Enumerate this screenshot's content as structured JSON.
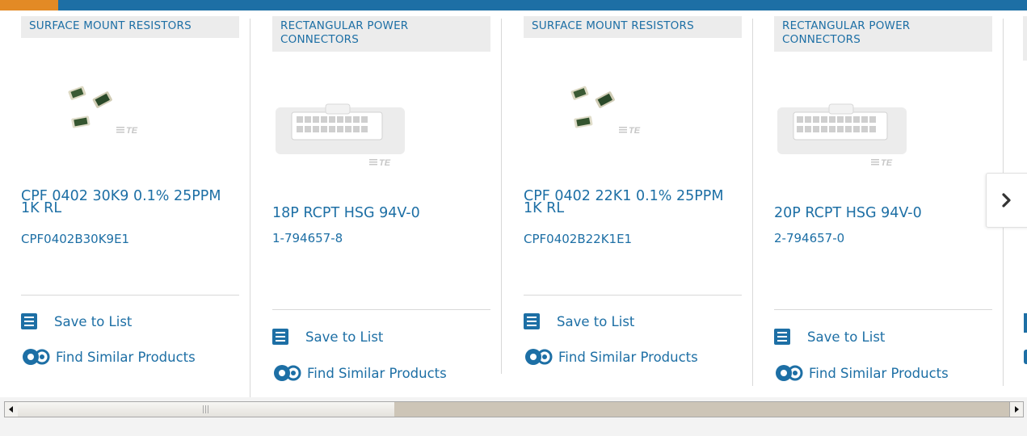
{
  "products": [
    {
      "category": "SURFACE MOUNT RESISTORS",
      "image_alt": "surface mount resistors image",
      "logo": "TE",
      "title": "CPF 0402 30K9 0.1% 25PPM 1K RL",
      "part_number": "CPF0402B30K9E1",
      "save_label": "Save to List",
      "similar_label": "Find Similar Products"
    },
    {
      "category": "RECTANGULAR POWER CONNECTORS",
      "image_alt": "rectangular power connector housing image",
      "logo": "TE",
      "title": "18P RCPT HSG 94V-0",
      "part_number": "1-794657-8",
      "save_label": "Save to List",
      "similar_label": "Find Similar Products"
    },
    {
      "category": "SURFACE MOUNT RESISTORS",
      "image_alt": "surface mount resistors image",
      "logo": "TE",
      "title": "CPF 0402 22K1 0.1% 25PPM 1K RL",
      "part_number": "CPF0402B22K1E1",
      "save_label": "Save to List",
      "similar_label": "Find Similar Products"
    },
    {
      "category": "RECTANGULAR POWER CONNECTORS",
      "image_alt": "rectangular power connector housing image",
      "logo": "TE",
      "title": "20P RCPT HSG 94V-0",
      "part_number": "2-794657-0",
      "save_label": "Save to List",
      "similar_label": "Find Similar Products"
    }
  ],
  "carousel": {
    "next_icon": "chevron-right-icon"
  },
  "scrollbar": {
    "left_icon": "arrow-left-icon",
    "right_icon": "arrow-right-icon",
    "position_fraction": 0.0
  },
  "colors": {
    "accent": "#1d6fa5",
    "highlight": "#e38a25"
  }
}
